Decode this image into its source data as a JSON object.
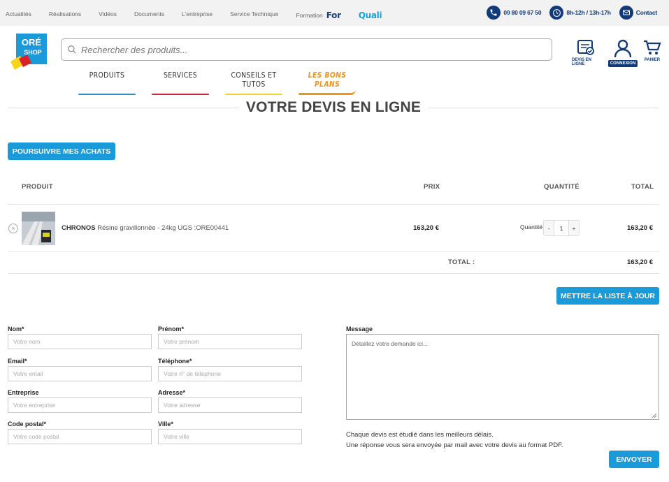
{
  "topnav": {
    "items": [
      "Actualités",
      "Réalisations",
      "Vidéos",
      "Documents",
      "L'entreprise",
      "Service Technique",
      "Formation"
    ],
    "brand_prefix": "For",
    "brand_suffix": "Quali"
  },
  "contact": {
    "phone": "09 80 09 67 50",
    "hours": "8h-12h / 13h-17h",
    "contact_label": "Contact"
  },
  "logo": {
    "line1": "ORÉ",
    "line2": "SHOP"
  },
  "search": {
    "placeholder": "Rechercher des produits..."
  },
  "header_icons": {
    "devis": "DEVIS EN LIGNE",
    "connexion": "CONNEXION",
    "panier": "PANIER"
  },
  "mainnav": [
    "PRODUITS",
    "SERVICES",
    "CONSEILS ET TUTOS",
    "LES BONS PLANS"
  ],
  "page_title": "VOTRE DEVIS EN LIGNE",
  "continue_button": "POURSUIVRE MES ACHATS",
  "table": {
    "headers": {
      "product": "PRODUIT",
      "price": "PRIX",
      "quantity": "QUANTITÉ",
      "total": "TOTAL"
    },
    "rows": [
      {
        "name": "CHRONOS",
        "detail": "Résine gravillonnée - 24kg UGS :ORE00441",
        "price": "163,20 €",
        "qty_label": "Quantité",
        "qty": "1",
        "minus": "-",
        "plus": "+",
        "total": "163,20 €"
      }
    ],
    "total_label": "TOTAL :",
    "total_value": "163,20 €"
  },
  "update_button": "METTRE LA LISTE À JOUR",
  "form": {
    "nom": {
      "label": "Nom*",
      "placeholder": "Votre nom"
    },
    "prenom": {
      "label": "Prénom*",
      "placeholder": "Votre prénom"
    },
    "email": {
      "label": "Email*",
      "placeholder": "Votre email"
    },
    "telephone": {
      "label": "Téléphone*",
      "placeholder": "Votre n° de téléphone"
    },
    "entreprise": {
      "label": "Entreprise",
      "placeholder": "Votre entreprise"
    },
    "adresse": {
      "label": "Adresse*",
      "placeholder": "Votre adresse"
    },
    "code_postal": {
      "label": "Code postal*",
      "placeholder": "Votre code postal"
    },
    "ville": {
      "label": "Ville*",
      "placeholder": "Votre ville"
    },
    "message": {
      "label": "Message",
      "placeholder": "Détaillez votre demande ici..."
    },
    "note_line1": "Chaque devis est étudié dans les meilleurs délais.",
    "note_line2": "Une réponse vous sera envoyée par mail avec votre devis au format PDF.",
    "send_button": "ENVOYER"
  },
  "colors": {
    "accent_blue": "#1a9ad8",
    "navy": "#123a7a",
    "bons_plans_orange": "#f0941d"
  }
}
